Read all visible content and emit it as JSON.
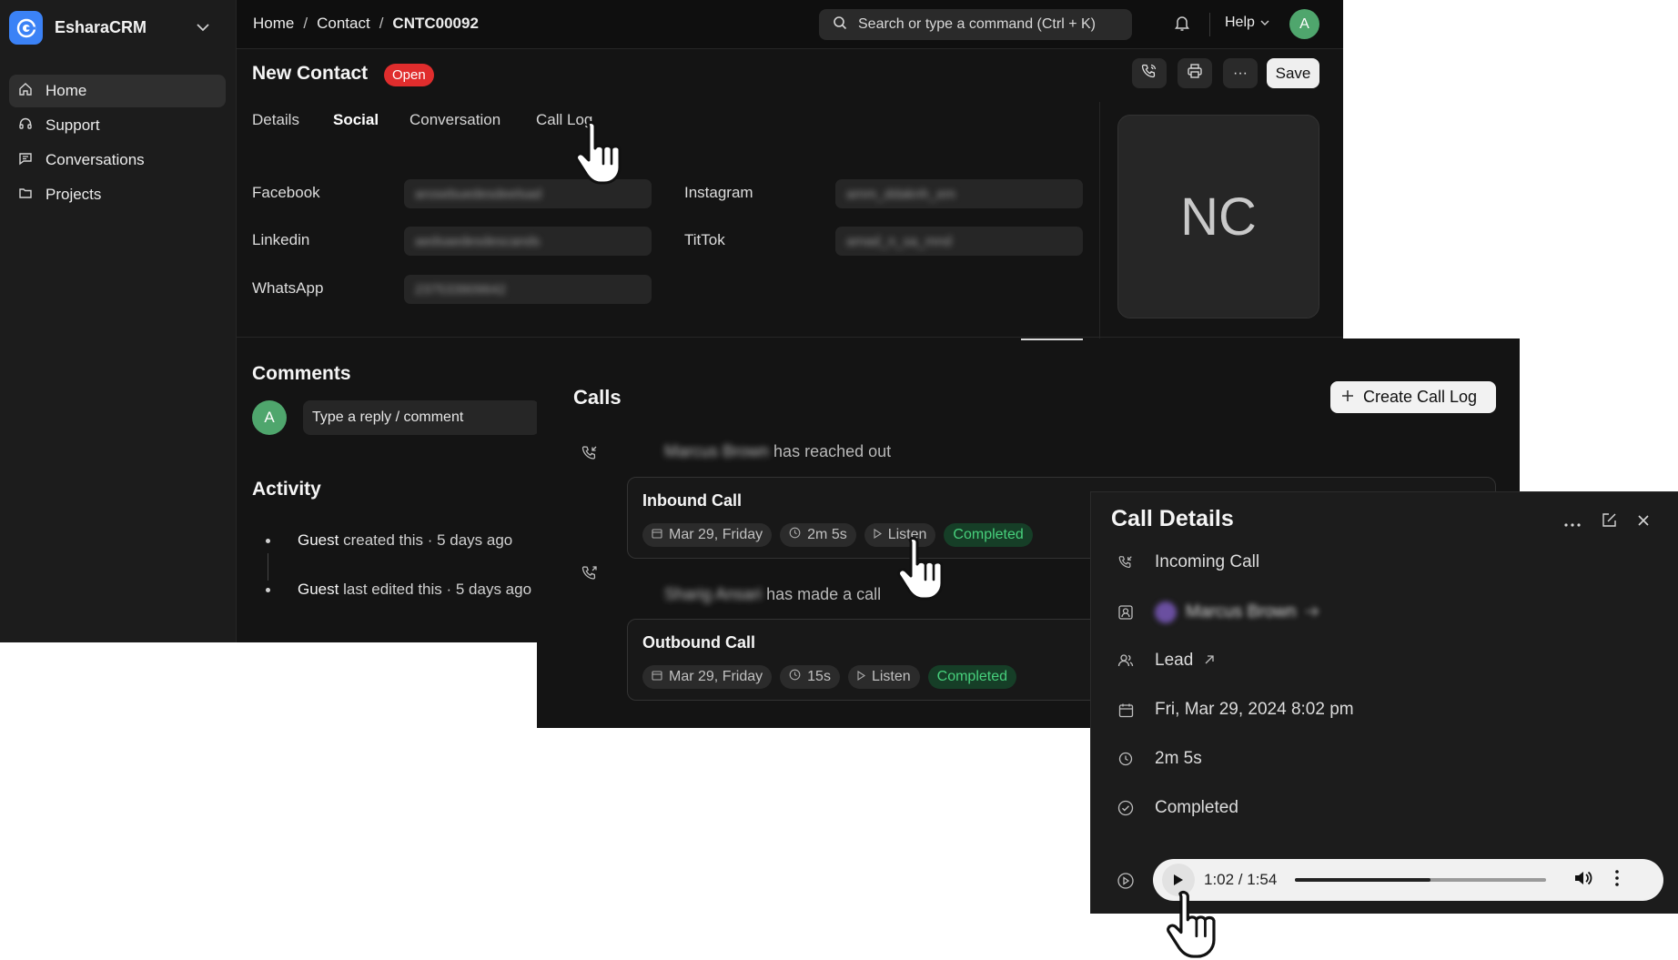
{
  "sidebar": {
    "brand": "EsharaCRM",
    "items": [
      {
        "label": "Home",
        "icon": "home-icon",
        "active": true
      },
      {
        "label": "Support",
        "icon": "headset-icon",
        "active": false
      },
      {
        "label": "Conversations",
        "icon": "chat-icon",
        "active": false
      },
      {
        "label": "Projects",
        "icon": "folder-icon",
        "active": false
      }
    ]
  },
  "topbar": {
    "breadcrumb": [
      "Home",
      "Contact",
      "CNTC00092"
    ],
    "separator": "/",
    "search_placeholder": "Search or type a command (Ctrl + K)",
    "help_label": "Help",
    "avatar_initial": "A"
  },
  "header": {
    "title": "New Contact",
    "status": "Open",
    "save_label": "Save",
    "more_label": "···"
  },
  "tabs": [
    {
      "label": "Details",
      "active": false
    },
    {
      "label": "Social",
      "active": true
    },
    {
      "label": "Conversation",
      "active": false
    },
    {
      "label": "Call Log",
      "active": false
    }
  ],
  "social": {
    "facebook": {
      "label": "Facebook",
      "value": "arosebuedesdeelsad"
    },
    "instagram": {
      "label": "Instagram",
      "value": "amm_ddaknh_em"
    },
    "linkedin": {
      "label": "Linkedin",
      "value": "aedsaedesdescands"
    },
    "tiktok": {
      "label": "TitTok",
      "value": "amad_n_sa_mnd"
    },
    "whatsapp": {
      "label": "WhatsApp",
      "value": "237533909642"
    }
  },
  "avatar_initials": "NC",
  "comments": {
    "title": "Comments",
    "avatar_initial": "A",
    "placeholder": "Type a reply / comment"
  },
  "activity": {
    "title": "Activity",
    "entries": [
      {
        "who": "Guest",
        "text": "created this · 5 days ago"
      },
      {
        "who": "Guest",
        "text": "last edited this · 5 days ago"
      }
    ]
  },
  "calls": {
    "title": "Calls",
    "create_label": "Create Call Log",
    "items": [
      {
        "who": "Marcus Brown",
        "event": "has reached out",
        "title": "Inbound Call",
        "date": "Mar 29, Friday",
        "duration": "2m 5s",
        "listen": "Listen",
        "status": "Completed"
      },
      {
        "who": "Sharig Ansari",
        "event": "has made a call",
        "title": "Outbound Call",
        "date": "Mar 29, Friday",
        "duration": "15s",
        "listen": "Listen",
        "status": "Completed"
      }
    ]
  },
  "details": {
    "title": "Call Details",
    "type": "Incoming Call",
    "contact": "Marcus Brown",
    "reference": "Lead",
    "datetime": "Fri, Mar 29, 2024 8:02 pm",
    "duration": "2m 5s",
    "status": "Completed",
    "audio": {
      "time": "1:02 / 1:54",
      "progress": 0.54
    }
  },
  "colors": {
    "accent_blue": "#3b82f6",
    "open_red": "#e02d2d",
    "completed_green": "#47d07c",
    "avatar_green": "#4fa66d"
  }
}
